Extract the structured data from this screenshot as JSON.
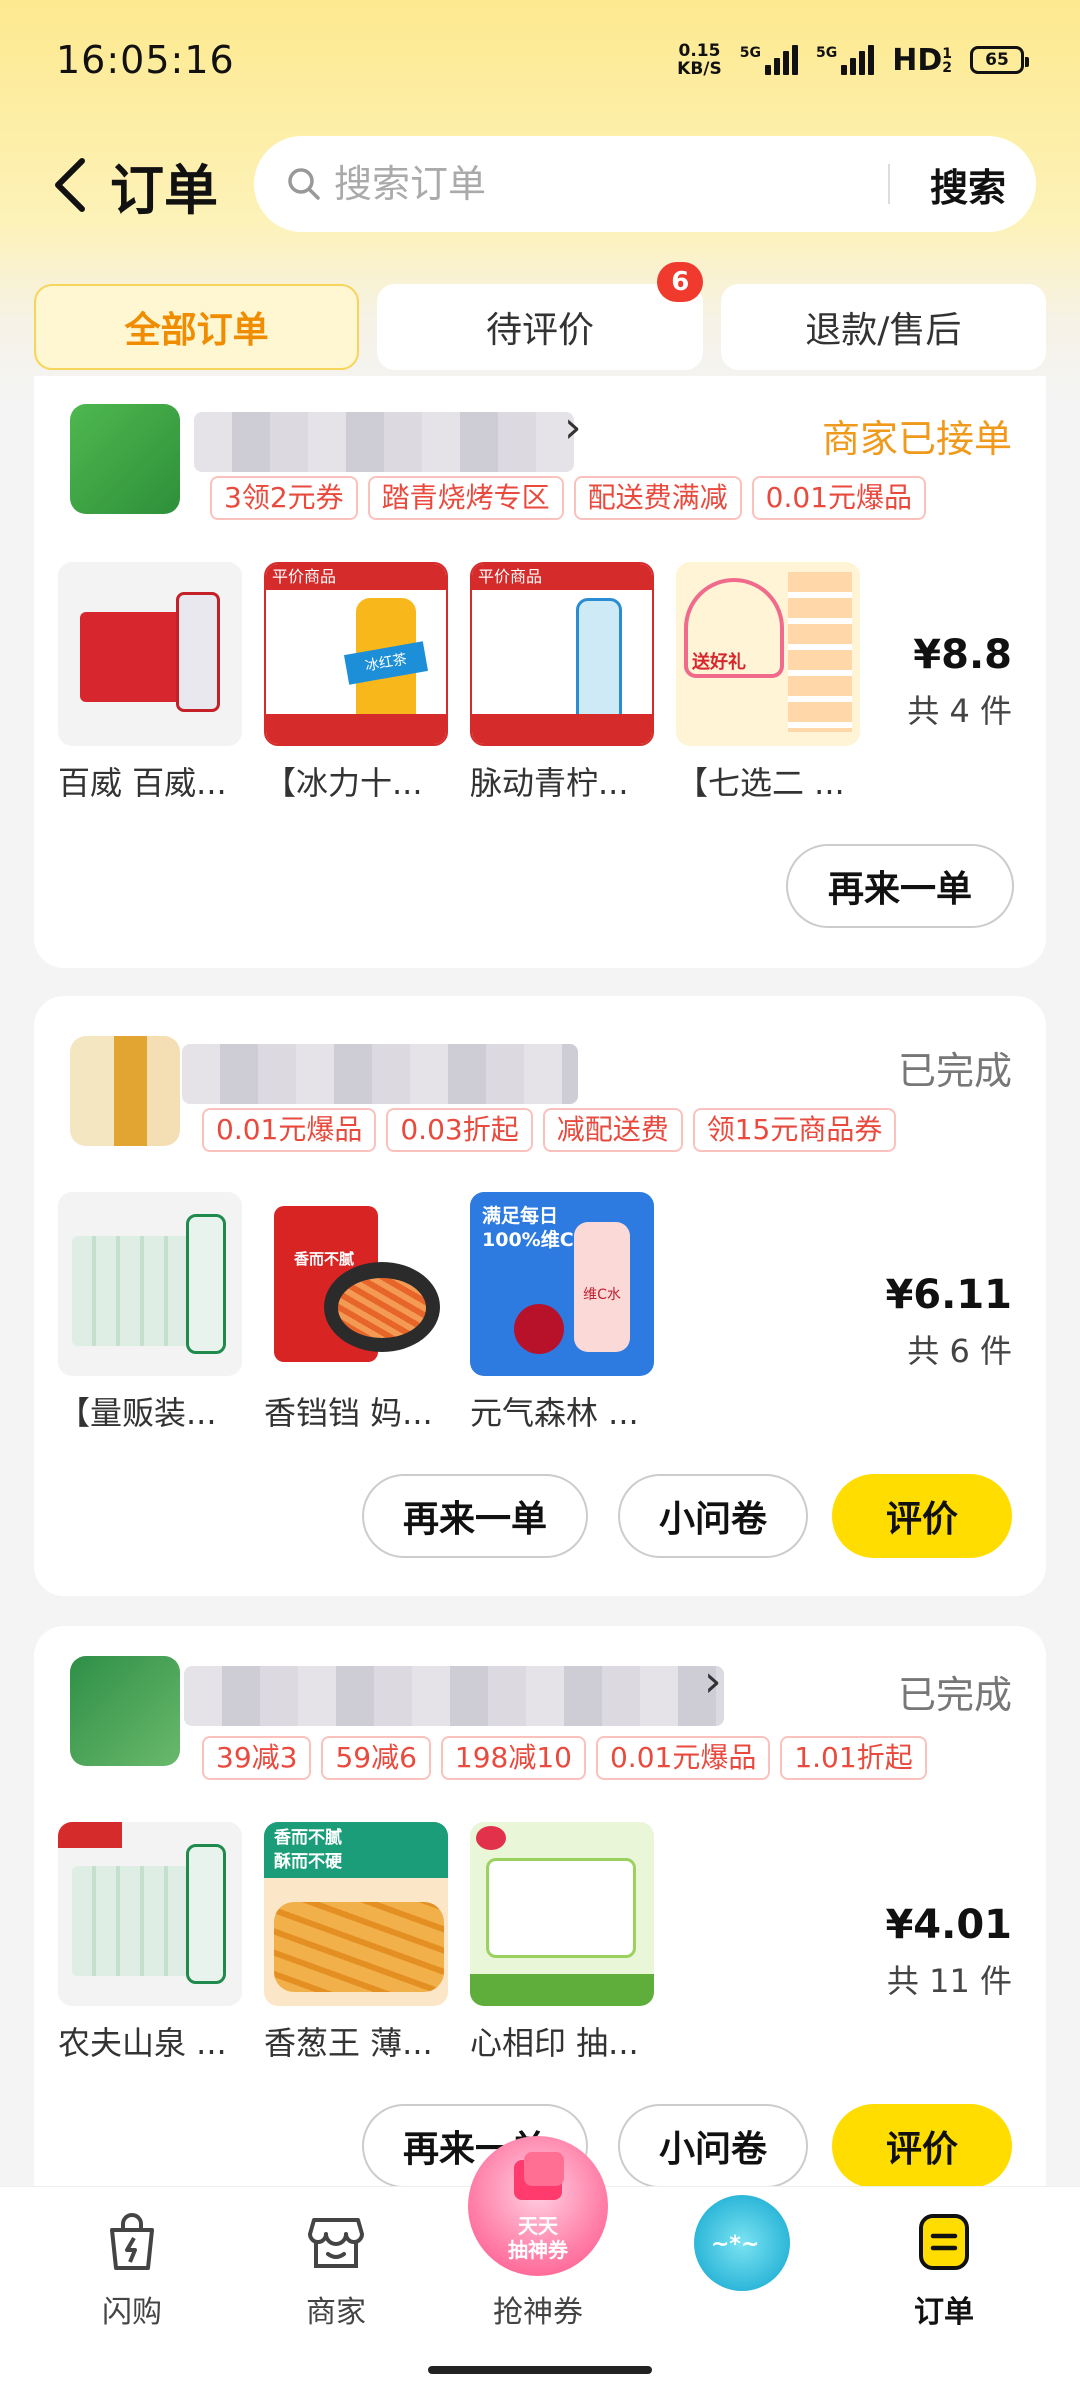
{
  "status_bar": {
    "time": "16:05:16",
    "net_speed_value": "0.15",
    "net_speed_unit": "KB/S",
    "sim1_label": "5G",
    "sim2_label": "5G",
    "hd_label": "HD",
    "hd_sub": "1",
    "hd_sub2": "2",
    "battery": "65"
  },
  "header": {
    "title": "订单",
    "back_icon": "chevron-left-icon",
    "search_placeholder": "搜索订单",
    "search_button": "搜索"
  },
  "tabs": [
    {
      "label": "全部订单",
      "active": true
    },
    {
      "label": "待评价",
      "badge": "6"
    },
    {
      "label": "退款/售后"
    }
  ],
  "orders": [
    {
      "status": "商家已接单",
      "tags": [
        "3领2元券",
        "踏青烧烤专区",
        "配送费满减",
        "0.01元爆品"
      ],
      "products": [
        "百威 百威...",
        "【冰力十...",
        "脉动青柠...",
        "【七选二 ..."
      ],
      "price": "¥8.8",
      "quantity": "共 4 件",
      "buttons": {
        "reorder": "再来一单"
      }
    },
    {
      "status": "已完成",
      "tags": [
        "0.01元爆品",
        "0.03折起",
        "减配送费",
        "领15元商品券"
      ],
      "products": [
        "【量贩装...",
        "香铛铛 妈...",
        "元气森林 ..."
      ],
      "price": "¥6.11",
      "quantity": "共 6 件",
      "buttons": {
        "reorder": "再来一单",
        "survey": "小问卷",
        "review": "评价"
      }
    },
    {
      "status": "已完成",
      "tags": [
        "39减3",
        "59减6",
        "198减10",
        "0.01元爆品",
        "1.01折起"
      ],
      "products": [
        "农夫山泉 ...",
        "香葱王 薄...",
        "心相印 抽..."
      ],
      "price": "¥4.01",
      "quantity": "共 11 件",
      "buttons": {
        "reorder": "再来一单",
        "survey": "小问卷",
        "review": "评价"
      }
    }
  ],
  "product_thumb_texts": {
    "bottle_label": "冰红茶",
    "promo_label": "平价商品",
    "gift_label": "送好礼",
    "vita_line1": "满足每日",
    "vita_line2": "100%维C",
    "vita_label": "维C水",
    "snack_label1": "香而不腻",
    "snack_label2": "酥而不硬"
  },
  "bottom_nav": [
    {
      "label": "闪购",
      "icon": "shopping-bag-icon"
    },
    {
      "label": "商家",
      "icon": "store-icon"
    },
    {
      "label": "抢神券",
      "icon": "coupon-icon"
    },
    {
      "label": "",
      "icon": "ice-festival-icon"
    },
    {
      "label": "订单",
      "icon": "orders-icon",
      "active": true
    }
  ],
  "promo": {
    "line1": "天天",
    "line2": "抽神券"
  },
  "colors": {
    "accent_yellow": "#ffdd00",
    "status_orange": "#f09a1c",
    "tag_red": "#e94a3d",
    "badge_red": "#f03a2e"
  }
}
